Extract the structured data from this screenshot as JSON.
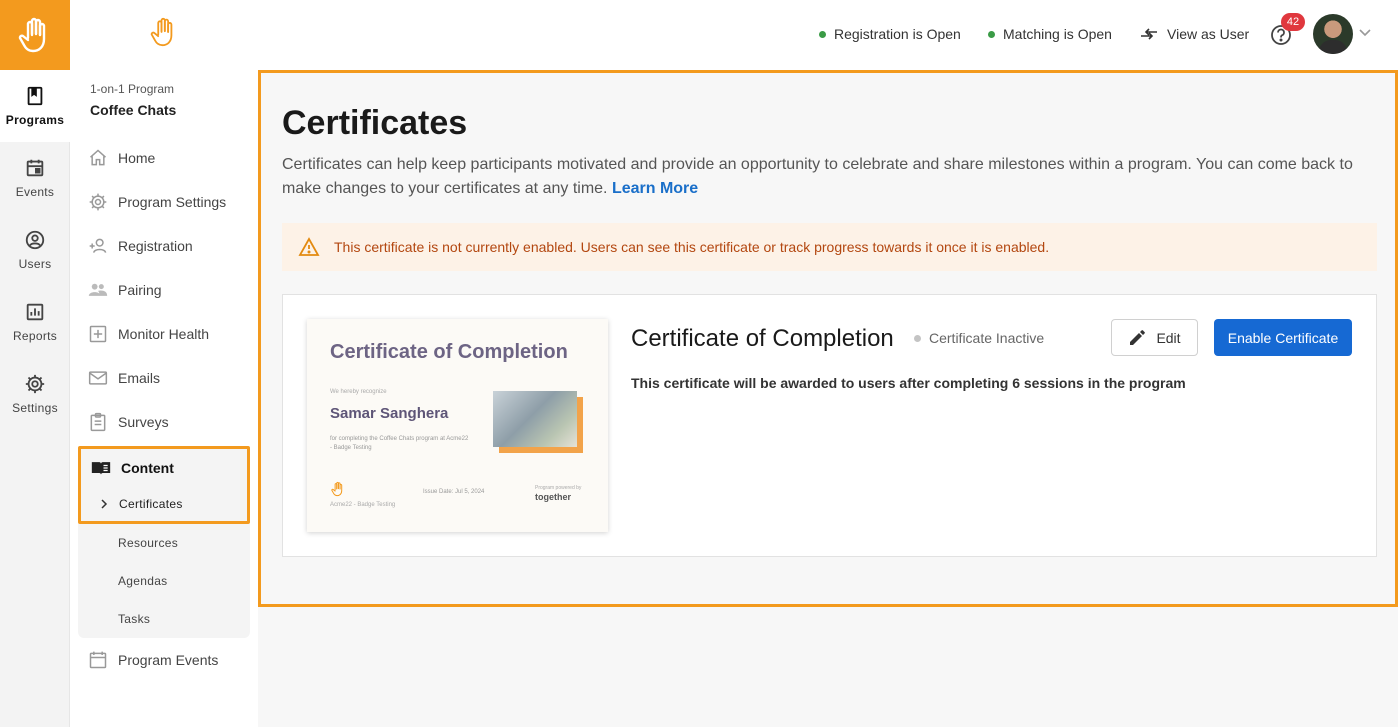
{
  "rail": {
    "items": [
      {
        "label": "Programs"
      },
      {
        "label": "Events"
      },
      {
        "label": "Users"
      },
      {
        "label": "Reports"
      },
      {
        "label": "Settings"
      }
    ]
  },
  "sidebar": {
    "program_kind": "1-on-1 Program",
    "program_name": "Coffee Chats",
    "items": [
      {
        "label": "Home"
      },
      {
        "label": "Program Settings"
      },
      {
        "label": "Registration"
      },
      {
        "label": "Pairing"
      },
      {
        "label": "Monitor Health"
      },
      {
        "label": "Emails"
      },
      {
        "label": "Surveys"
      }
    ],
    "content": {
      "label": "Content",
      "active_sub": "Certificates",
      "subs": [
        {
          "label": "Resources"
        },
        {
          "label": "Agendas"
        },
        {
          "label": "Tasks"
        }
      ]
    },
    "program_events": "Program Events"
  },
  "topbar": {
    "registration_status": "Registration is Open",
    "matching_status": "Matching is Open",
    "view_as_user": "View as User",
    "notification_count": "42",
    "status_color": "#3a9b46"
  },
  "main": {
    "title": "Certificates",
    "description": "Certificates can help keep participants motivated and provide an opportunity to celebrate and share milestones within a program. You can come back to make changes to your certificates at any time.",
    "learn_more": "Learn More",
    "alert_text": "This certificate is not currently enabled. Users can see this certificate or track progress towards it once it is enabled.",
    "certificate": {
      "name": "Certificate of Completion",
      "status": "Certificate Inactive",
      "description": "This certificate will be awarded to users after completing 6 sessions in the program",
      "edit_label": "Edit",
      "enable_label": "Enable Certificate",
      "preview": {
        "title": "Certificate of Completion",
        "recognize": "We hereby recognize",
        "recipient": "Samar Sanghera",
        "for_text": "for completing the Coffee Chats program at Acme22 - Badge Testing",
        "org": "Acme22 - Badge Testing",
        "issue_date": "Issue Date: Jul 5, 2024",
        "powered_by": "Program powered by",
        "brand": "together"
      }
    }
  },
  "colors": {
    "accent": "#f39a1e",
    "primary_button": "#1669d3",
    "link": "#1a6fc9",
    "alert_text": "#b34710"
  }
}
